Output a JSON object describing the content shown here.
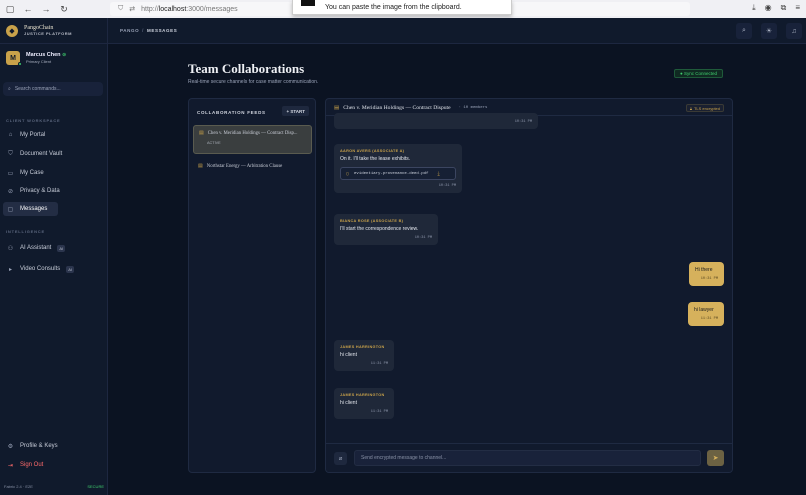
{
  "browser": {
    "url_prefix": "http://",
    "url_host": "localhost",
    "url_path": ":3000/messages",
    "toast": "You can paste the image from the clipboard."
  },
  "sidebar": {
    "brand_name": "PangoChain",
    "brand_sub": "JUSTICE PLATFORM",
    "user_initial": "M",
    "user_name": "Marcus Chen",
    "user_role": "Primary Client",
    "search_placeholder": "Search commands...",
    "section_workspace": "CLIENT WORKSPACE",
    "section_intel": "INTELLIGENCE",
    "items": [
      {
        "label": "My Portal"
      },
      {
        "label": "Document Vault"
      },
      {
        "label": "My Case"
      },
      {
        "label": "Privacy & Data"
      },
      {
        "label": "Messages"
      },
      {
        "label": "AI Assistant",
        "badge": "AI"
      },
      {
        "label": "Video Consults",
        "badge": "AI"
      }
    ],
    "profile": "Profile & Keys",
    "signout": "Sign Out",
    "version": "Fabric 2.4 · E2E",
    "version_status": "SECURE"
  },
  "topbar": {
    "crumb_root": "PANGO",
    "crumb_sep": "/",
    "crumb_current": "MESSAGES"
  },
  "page": {
    "title": "Team Collaborations",
    "subtitle": "Real-time secure channels for case matter communication.",
    "sync": "● Sync Connected"
  },
  "feeds": {
    "header": "COLLABORATION FEEDS",
    "start": "+ START",
    "items": [
      {
        "title": "Chen v. Meridian Holdings — Contract Disp...",
        "status": "ACTIVE"
      },
      {
        "title": "Northstar Energy — Arbitration Clause"
      }
    ]
  },
  "chat": {
    "title": "Chen v. Meridian Holdings — Contract Dispute",
    "members": "· 10 members",
    "encryption": "TLS encrypted",
    "messages": [
      {
        "author": "",
        "text": "",
        "time": "10:31 PM"
      },
      {
        "author": "AARON AVERS (ASSOCIATE A)",
        "text": "On it. I'll take the lease exhibits.",
        "attachment": "evidentiary-provenance-deed.pdf",
        "time": "10:31 PM"
      },
      {
        "author": "BIANCA ROSE (ASSOCIATE B)",
        "text": "I'll start the correspondence review.",
        "time": "10:31 PM"
      },
      {
        "author": "",
        "text": "Hi there",
        "time": "10:31 PM"
      },
      {
        "author": "",
        "text": "hi lawyer",
        "time": "11:31 PM"
      },
      {
        "author": "JAMES HARRINGTON",
        "text": "hi client",
        "time": "11:31 PM"
      },
      {
        "author": "JAMES HARRINGTON",
        "text": "hi client",
        "time": "11:31 PM"
      }
    ],
    "composer_placeholder": "Send encrypted message to channel..."
  }
}
